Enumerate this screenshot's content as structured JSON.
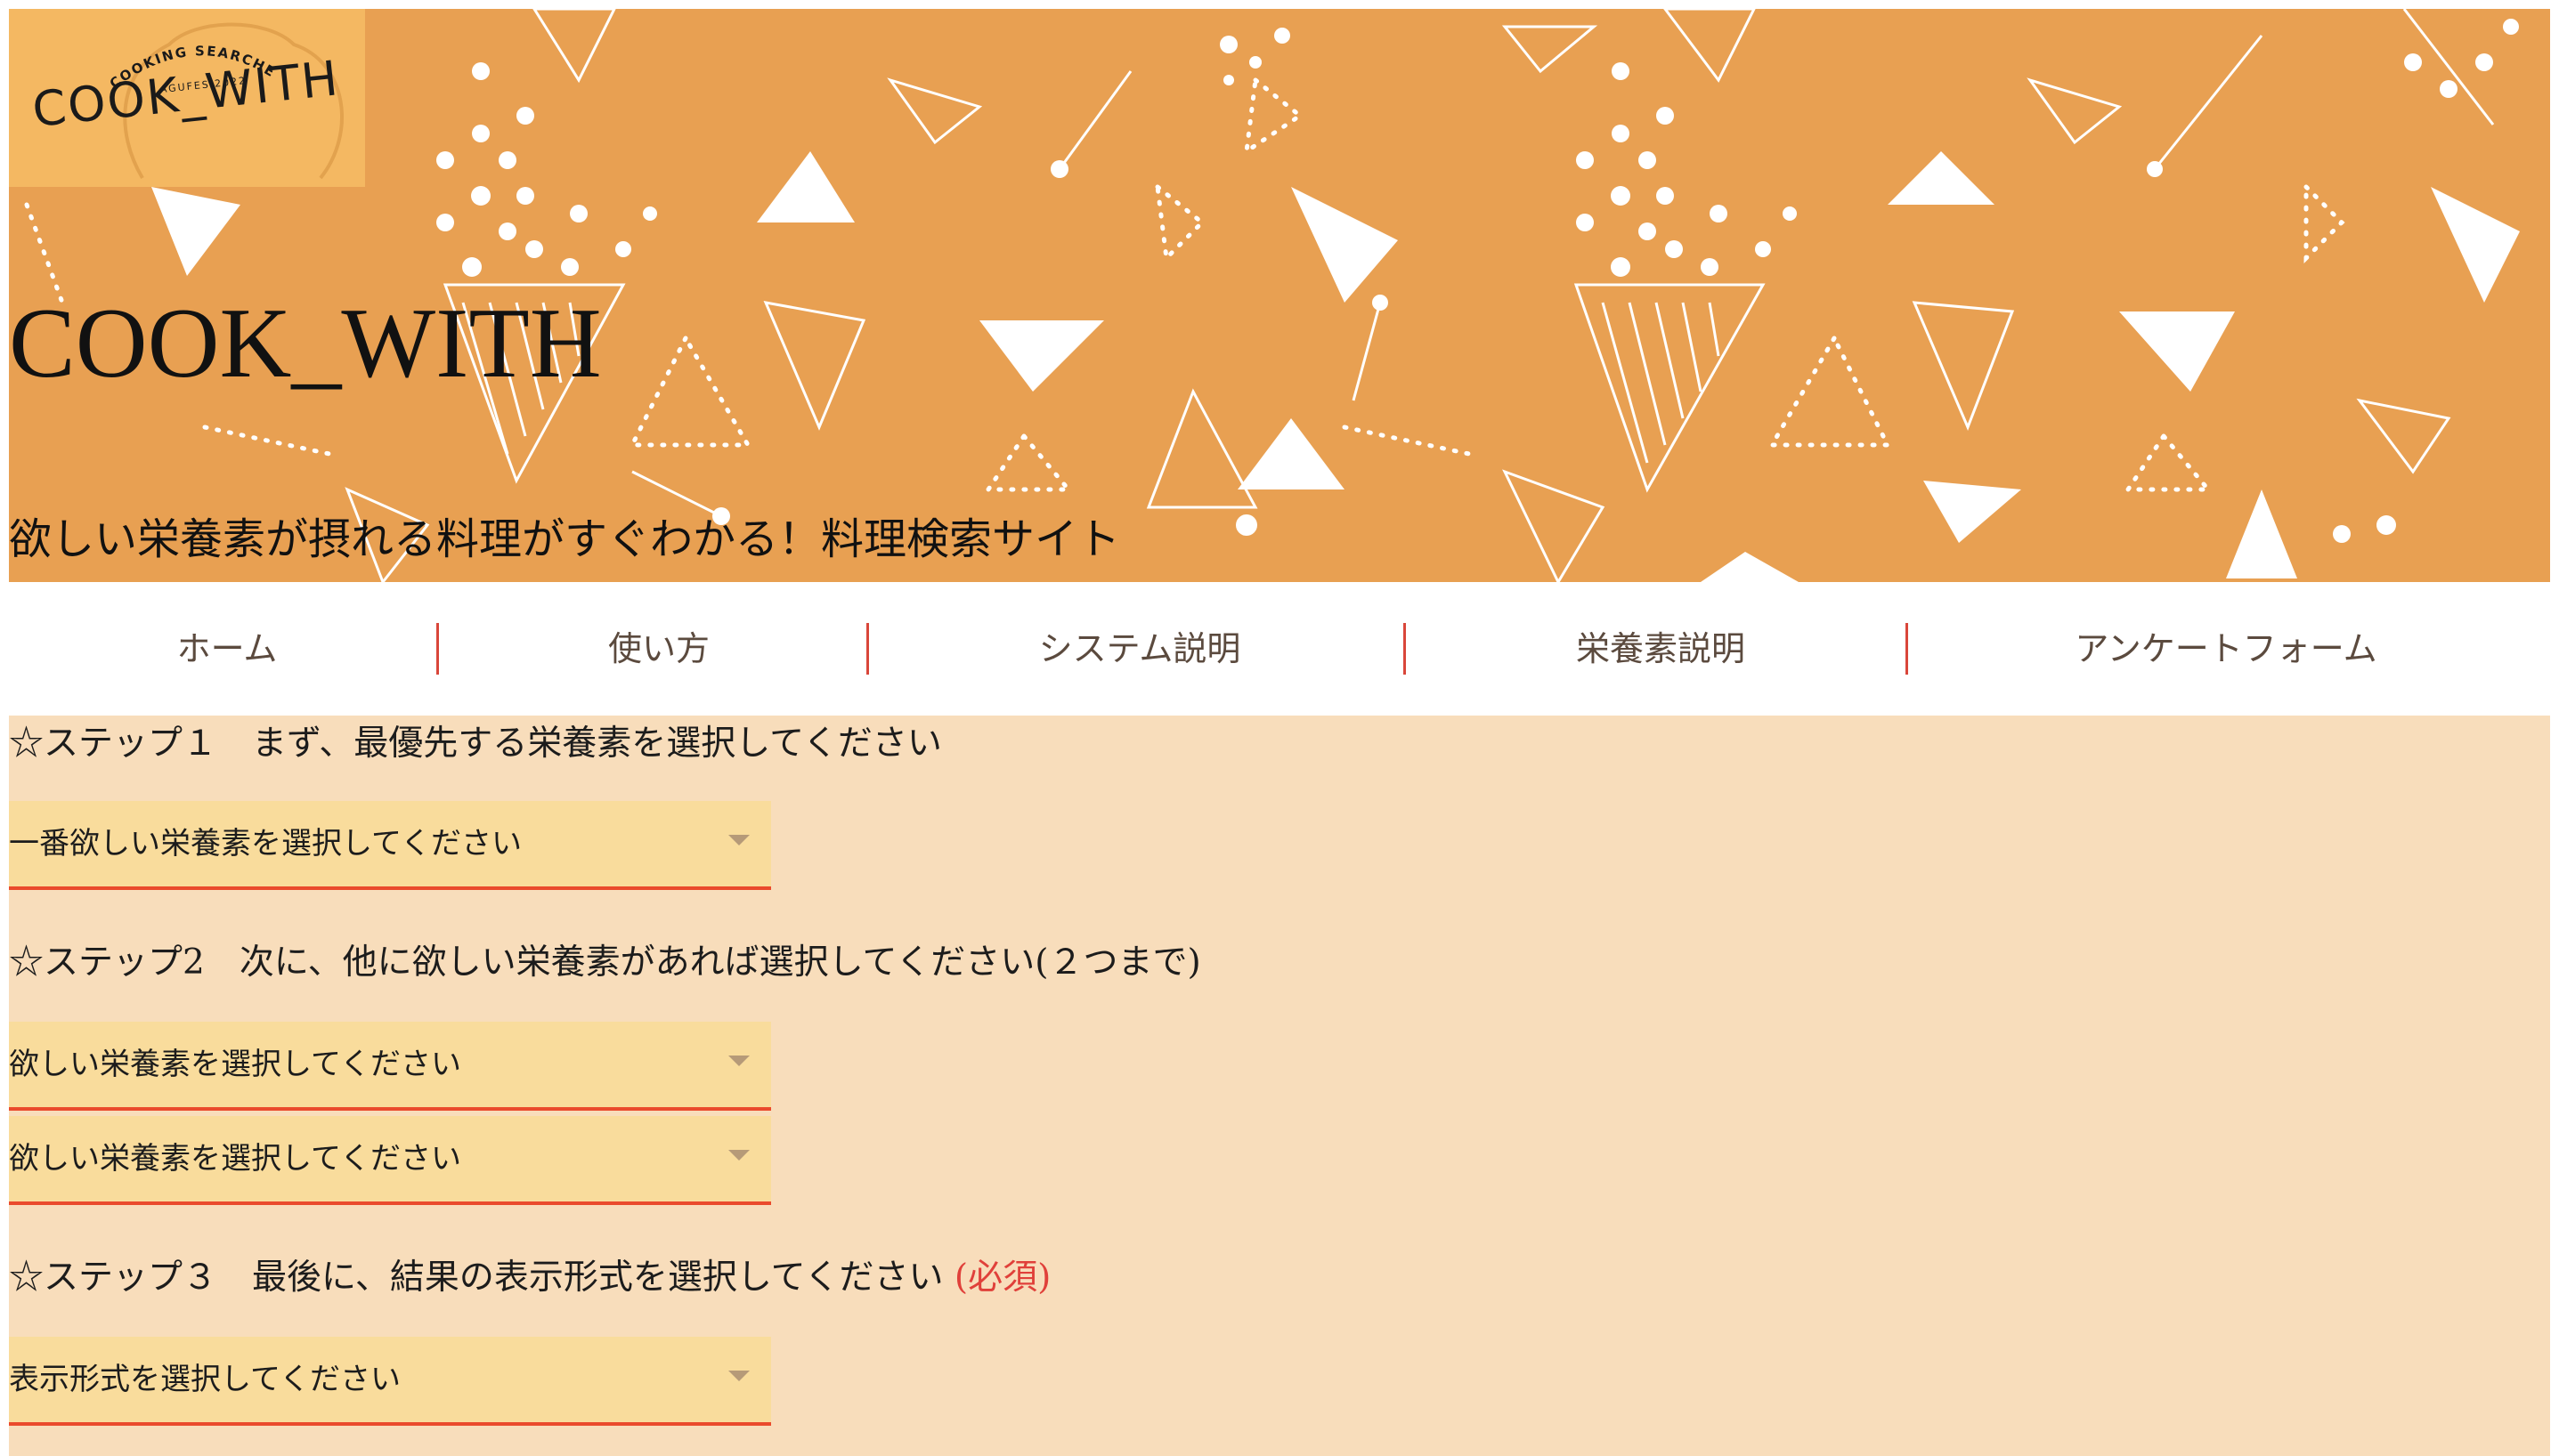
{
  "hero": {
    "logo": {
      "arc_text": "COOKING SEARCHER",
      "sub_text": "AGUFES 2022",
      "main_text": "COOK_WITH"
    },
    "title": "COOK_WITH",
    "tagline": "欲しい栄養素が摂れる料理がすぐわかる！料理検索サイト",
    "background_color": "#e8a052"
  },
  "nav": {
    "items": [
      {
        "label": "ホーム"
      },
      {
        "label": "使い方"
      },
      {
        "label": "システム説明"
      },
      {
        "label": "栄養素説明"
      },
      {
        "label": "アンケートフォーム"
      }
    ],
    "separator_color": "#d9463a"
  },
  "form": {
    "step1": {
      "heading": "☆ステップ１　まず、最優先する栄養素を選択してください",
      "select_value": "一番欲しい栄養素を選択してください"
    },
    "step2": {
      "heading": "☆ステップ2　次に、他に欲しい栄養素があれば選択してください(２つまで)",
      "select_1_value": "欲しい栄養素を選択してください",
      "select_2_value": "欲しい栄養素を選択してください"
    },
    "step3": {
      "heading": "☆ステップ３　最後に、結果の表示形式を選択してください",
      "required_label": "(必須)",
      "select_value": "表示形式を選択してください"
    }
  },
  "colors": {
    "content_background": "#f8ddbb",
    "select_background": "#f9dc9c",
    "select_underline": "#ea4a2c",
    "required_text": "#e0403a"
  }
}
